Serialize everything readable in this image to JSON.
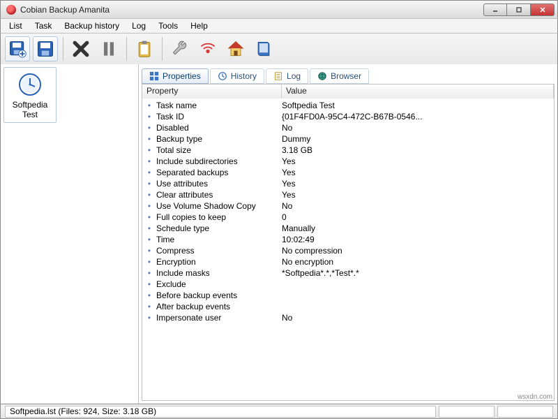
{
  "window": {
    "title": "Cobian Backup Amanita"
  },
  "menu": {
    "items": [
      "List",
      "Task",
      "Backup history",
      "Log",
      "Tools",
      "Help"
    ]
  },
  "sidebar": {
    "task_label": "Softpedia Test"
  },
  "tabs": {
    "properties": "Properties",
    "history": "History",
    "log": "Log",
    "browser": "Browser"
  },
  "columns": {
    "property": "Property",
    "value": "Value"
  },
  "properties": [
    {
      "label": "Task name",
      "value": "Softpedia Test"
    },
    {
      "label": "Task ID",
      "value": "{01F4FD0A-95C4-472C-B67B-0546..."
    },
    {
      "label": "Disabled",
      "value": "No"
    },
    {
      "label": "Backup type",
      "value": "Dummy"
    },
    {
      "label": "Total size",
      "value": "3.18 GB"
    },
    {
      "label": "Include subdirectories",
      "value": "Yes"
    },
    {
      "label": "Separated backups",
      "value": "Yes"
    },
    {
      "label": "Use attributes",
      "value": "Yes"
    },
    {
      "label": "Clear attributes",
      "value": "Yes"
    },
    {
      "label": "Use Volume Shadow Copy",
      "value": "No"
    },
    {
      "label": "Full copies to keep",
      "value": "0"
    },
    {
      "label": "Schedule type",
      "value": "Manually"
    },
    {
      "label": "Time",
      "value": "10:02:49"
    },
    {
      "label": "Compress",
      "value": "No compression"
    },
    {
      "label": "Encryption",
      "value": "No encryption"
    },
    {
      "label": "Include masks",
      "value": "*Softpedia*.*,*Test*.*"
    },
    {
      "label": "Exclude",
      "value": ""
    },
    {
      "label": "Before backup events",
      "value": ""
    },
    {
      "label": "After backup events",
      "value": ""
    },
    {
      "label": "Impersonate user",
      "value": "No"
    }
  ],
  "status": {
    "text": "Softpedia.lst (Files: 924, Size: 3.18 GB)"
  },
  "watermark": "wsxdn.com"
}
